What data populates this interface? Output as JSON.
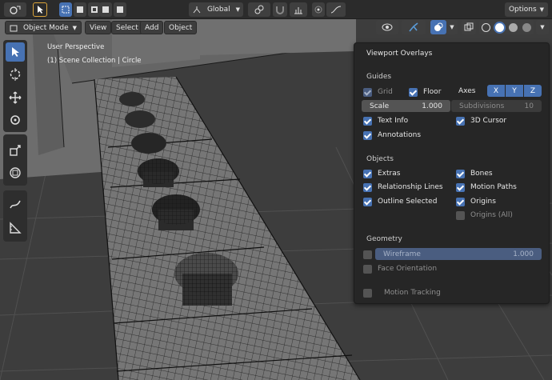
{
  "topbar": {
    "orientation_label": "Global",
    "options_label": "Options"
  },
  "header": {
    "mode_label": "Object Mode",
    "menu": [
      "View",
      "Select",
      "Add",
      "Object"
    ]
  },
  "viewport": {
    "view_name": "User Perspective",
    "collection_info": "(1) Scene Collection | Circle"
  },
  "overlays": {
    "title": "Viewport Overlays",
    "guides": {
      "heading": "Guides",
      "grid_label": "Grid",
      "floor_label": "Floor",
      "axes_label": "Axes",
      "axes": [
        "X",
        "Y",
        "Z"
      ],
      "scale_label": "Scale",
      "scale_value": "1.000",
      "subdivisions_label": "Subdivisions",
      "subdivisions_value": "10",
      "text_info_label": "Text Info",
      "cursor_label": "3D Cursor",
      "annotations_label": "Annotations"
    },
    "objects": {
      "heading": "Objects",
      "extras": "Extras",
      "bones": "Bones",
      "relationship_lines": "Relationship Lines",
      "motion_paths": "Motion Paths",
      "outline_selected": "Outline Selected",
      "origins": "Origins",
      "origins_all": "Origins (All)"
    },
    "geometry": {
      "heading": "Geometry",
      "wireframe_label": "Wireframe",
      "wireframe_value": "1.000",
      "face_orientation": "Face Orientation"
    },
    "motion_tracking": "Motion Tracking"
  },
  "colors": {
    "accent": "#4772b3",
    "panel_bg": "#262626",
    "header_bg": "#2b2b2b"
  }
}
